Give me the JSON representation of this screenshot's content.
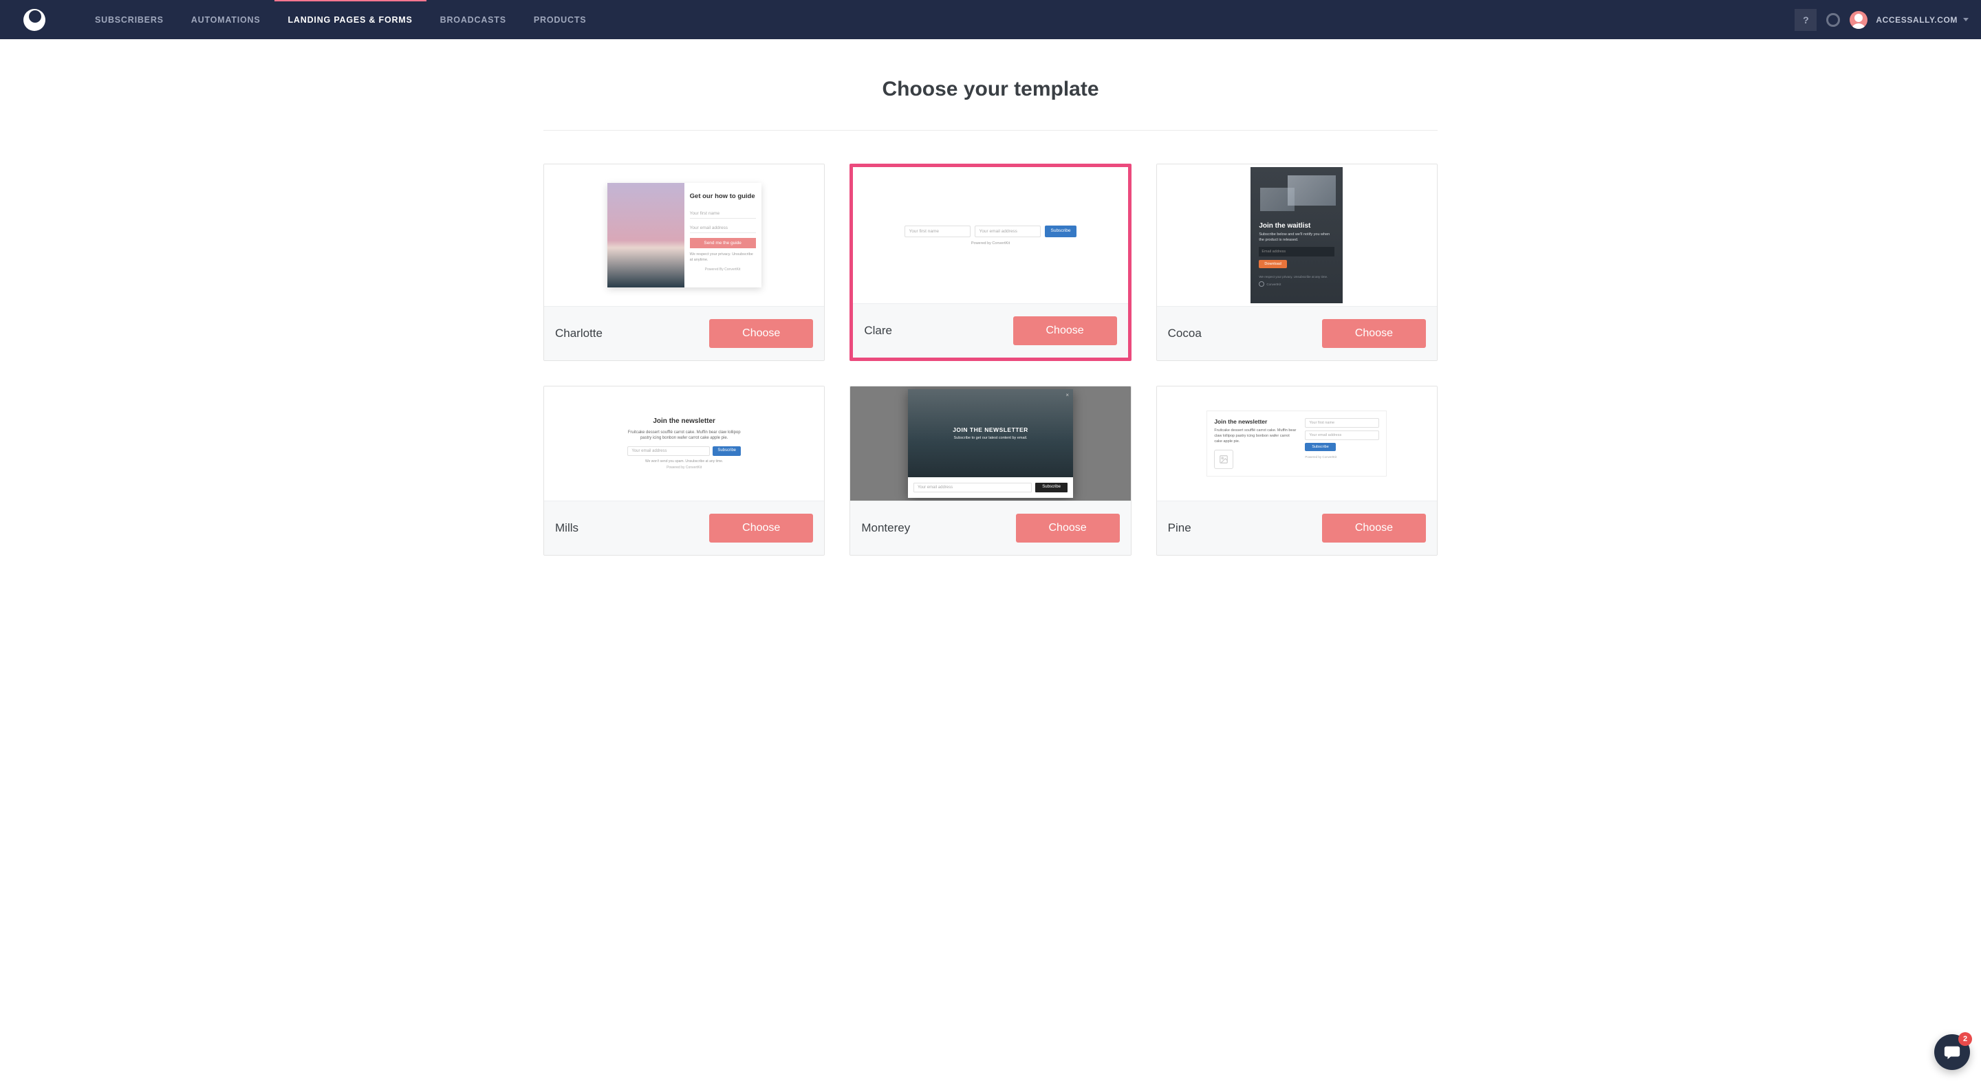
{
  "nav": {
    "items": [
      {
        "label": "SUBSCRIBERS",
        "active": false
      },
      {
        "label": "AUTOMATIONS",
        "active": false
      },
      {
        "label": "LANDING PAGES & FORMS",
        "active": true
      },
      {
        "label": "BROADCASTS",
        "active": false
      },
      {
        "label": "PRODUCTS",
        "active": false
      }
    ],
    "help_label": "?",
    "account_label": "ACCESSALLY.COM"
  },
  "page": {
    "title": "Choose your template"
  },
  "templates": [
    {
      "name": "Charlotte",
      "choose_label": "Choose",
      "highlighted": false,
      "preview_kind": "charlotte",
      "preview": {
        "heading": "Get our how to guide",
        "field_first_name": "Your first name",
        "field_email": "Your email address",
        "button": "Send me the guide",
        "disclaimer": "We respect your privacy. Unsubscribe at anytime.",
        "powered_by": "Powered By ConvertKit"
      }
    },
    {
      "name": "Clare",
      "choose_label": "Choose",
      "highlighted": true,
      "preview_kind": "clare",
      "preview": {
        "field_first_name": "Your first name",
        "field_email": "Your email address",
        "button": "Subscribe",
        "powered_by": "Powered by ConvertKit"
      }
    },
    {
      "name": "Cocoa",
      "choose_label": "Choose",
      "highlighted": false,
      "preview_kind": "cocoa",
      "preview": {
        "heading": "Join the waitlist",
        "sub": "Subscribe below and we'll notify you when the product is released.",
        "field_email": "Email address",
        "button": "Download",
        "disclaimer": "We respect your privacy. Unsubscribe at any time.",
        "powered_by": "ConvertKit"
      }
    },
    {
      "name": "Mills",
      "choose_label": "Choose",
      "highlighted": false,
      "preview_kind": "mills",
      "preview": {
        "heading": "Join the newsletter",
        "sub": "Fruitcake dessert soufflé carrot cake. Muffin bear claw lollipop pastry icing bonbon wafer carrot cake apple pie.",
        "field_email": "Your email address",
        "button": "Subscribe",
        "disclaimer": "We won't send you spam. Unsubscribe at any time.",
        "powered_by": "Powered by ConvertKit"
      }
    },
    {
      "name": "Monterey",
      "choose_label": "Choose",
      "highlighted": false,
      "preview_kind": "monterey",
      "preview": {
        "heading": "JOIN THE NEWSLETTER",
        "sub": "Subscribe to get our latest content by email.",
        "field_email": "Your email address",
        "button": "Subscribe"
      }
    },
    {
      "name": "Pine",
      "choose_label": "Choose",
      "highlighted": false,
      "preview_kind": "pine",
      "preview": {
        "heading": "Join the newsletter",
        "sub": "Fruitcake dessert soufflé carrot cake. Muffin bear claw lollipop pastry icing bonbon wafer carrot cake apple pie.",
        "field_first_name": "Your first name",
        "field_email": "Your email address",
        "button": "Subscribe",
        "powered_by": "Powered by ConvertKit"
      }
    }
  ],
  "chat": {
    "badge_count": "2"
  }
}
